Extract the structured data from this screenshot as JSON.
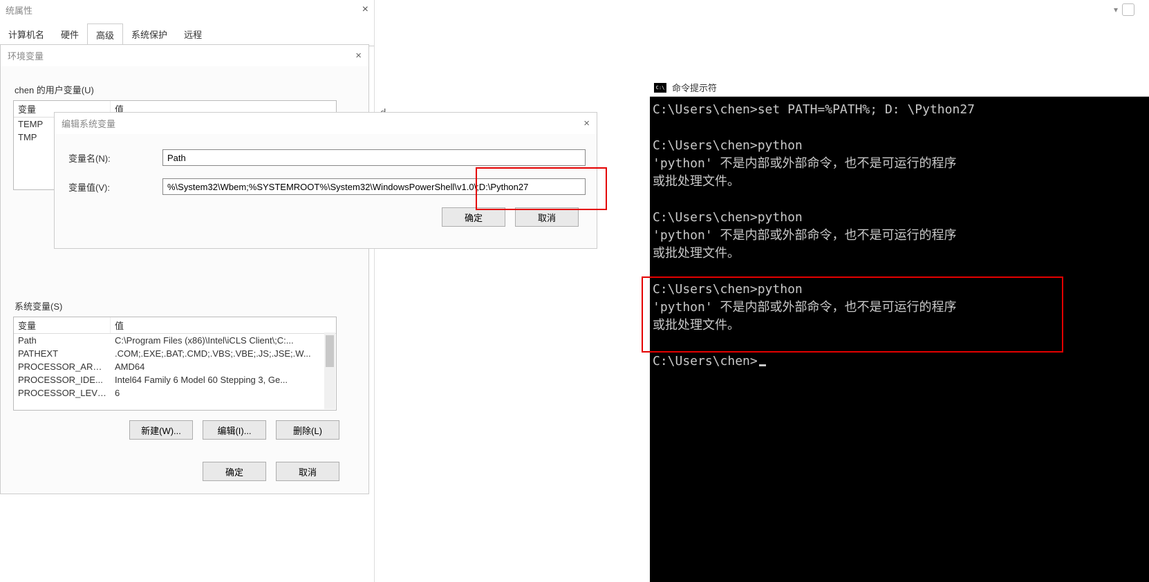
{
  "sys_props": {
    "title": "统属性",
    "tabs": [
      "计算机名",
      "硬件",
      "高级",
      "系统保护",
      "远程"
    ],
    "active_tab_index": 2
  },
  "env": {
    "title": "环境变量",
    "user_group_label": "chen 的用户变量(U)",
    "sys_group_label": "系统变量(S)",
    "col_var": "变量",
    "col_val": "值",
    "user_rows": [
      {
        "name": "TEMP",
        "value": ""
      },
      {
        "name": "TMP",
        "value": ""
      }
    ],
    "sys_rows": [
      {
        "name": "Path",
        "value": "C:\\Program Files (x86)\\Intel\\iCLS Client\\;C:..."
      },
      {
        "name": "PATHEXT",
        "value": ".COM;.EXE;.BAT;.CMD;.VBS;.VBE;.JS;.JSE;.W..."
      },
      {
        "name": "PROCESSOR_ARC...",
        "value": "AMD64"
      },
      {
        "name": "PROCESSOR_IDE...",
        "value": "Intel64 Family 6 Model 60 Stepping 3, Ge..."
      },
      {
        "name": "PROCESSOR_LEVEL",
        "value": "6"
      }
    ],
    "btn_new": "新建(W)...",
    "btn_edit": "编辑(I)...",
    "btn_delete": "删除(L)",
    "btn_ok": "确定",
    "btn_cancel": "取消"
  },
  "edit": {
    "title": "编辑系统变量",
    "name_label": "变量名(N):",
    "value_label": "变量值(V):",
    "name_value": "Path",
    "value_value": "%\\System32\\Wbem;%SYSTEMROOT%\\System32\\WindowsPowerShell\\v1.0\\;D:\\Python27",
    "btn_ok": "确定",
    "btn_cancel": "取消"
  },
  "ghost": "d.",
  "cmd": {
    "title": "命令提示符",
    "lines": [
      "C:\\Users\\chen>set PATH=%PATH%; D: \\Python27",
      "",
      "C:\\Users\\chen>python",
      "'python' 不是内部或外部命令，也不是可运行的程序",
      "或批处理文件。",
      "",
      "C:\\Users\\chen>python",
      "'python' 不是内部或外部命令，也不是可运行的程序",
      "或批处理文件。",
      "",
      "C:\\Users\\chen>python",
      "'python' 不是内部或外部命令，也不是可运行的程序",
      "或批处理文件。",
      "",
      "C:\\Users\\chen>"
    ]
  }
}
